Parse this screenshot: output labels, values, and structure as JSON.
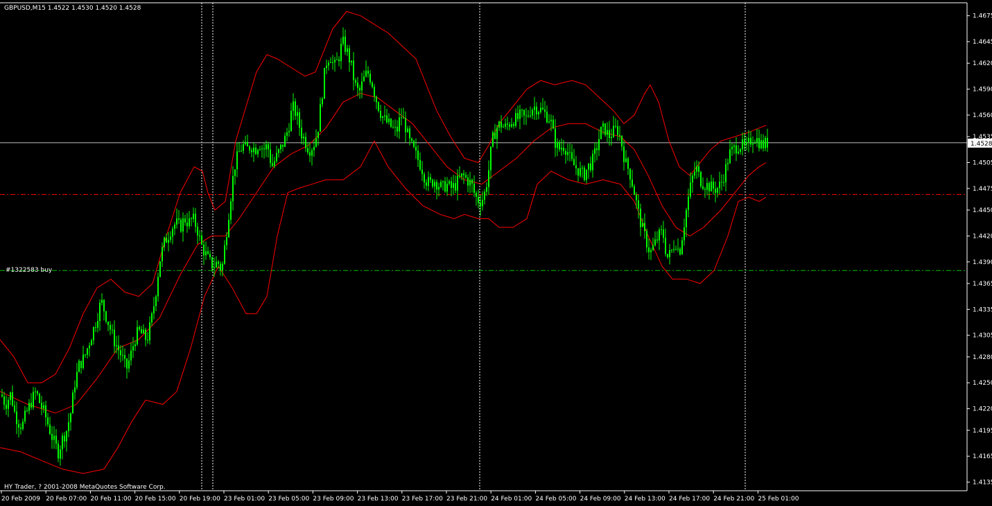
{
  "header": {
    "symbol_info": "GBPUSD,M15  1.4522 1.4530 1.4520 1.4528"
  },
  "footer": {
    "copyright": "HY Trader, ? 2001-2008 MetaQuotes Software Corp."
  },
  "order_label": "#1322583 buy",
  "current_price_label": "1.4528",
  "colors": {
    "background": "#000000",
    "candles": "#00ff00",
    "bands": "#ff0000",
    "bid_line": "#c0c0c0",
    "tp_line": "#ff0000",
    "order_line": "#00c000",
    "separator": "#ffffff",
    "axis": "#ffffff"
  },
  "chart_data": {
    "type": "candlestick",
    "symbol": "GBPUSD",
    "timeframe": "M15",
    "indicator": "Bollinger Bands",
    "ylim": [
      1.4125,
      1.469
    ],
    "y_ticks": [
      "1.4675",
      "1.4645",
      "1.4620",
      "1.4590",
      "1.4560",
      "1.4535",
      "1.4505",
      "1.4475",
      "1.4450",
      "1.4420",
      "1.4390",
      "1.4365",
      "1.4335",
      "1.4305",
      "1.4280",
      "1.4250",
      "1.4220",
      "1.4195",
      "1.4165",
      "1.4135"
    ],
    "x_ticks": [
      "20 Feb 2009",
      "20 Feb 07:00",
      "20 Feb 11:00",
      "20 Feb 15:00",
      "20 Feb 19:00",
      "23 Feb 01:00",
      "23 Feb 05:00",
      "23 Feb 09:00",
      "23 Feb 13:00",
      "23 Feb 17:00",
      "23 Feb 21:00",
      "24 Feb 01:00",
      "24 Feb 05:00",
      "24 Feb 09:00",
      "24 Feb 13:00",
      "24 Feb 17:00",
      "24 Feb 21:00",
      "25 Feb 01:00"
    ],
    "current_price": 1.4528,
    "horizontal_lines": [
      {
        "kind": "take-profit",
        "price": 1.4468
      },
      {
        "kind": "order",
        "price": 1.438
      }
    ],
    "close_path": [
      [
        0,
        1.424
      ],
      [
        8,
        1.4225
      ],
      [
        16,
        1.4238
      ],
      [
        20,
        1.4218
      ],
      [
        26,
        1.4205
      ],
      [
        32,
        1.42
      ],
      [
        38,
        1.4215
      ],
      [
        46,
        1.423
      ],
      [
        52,
        1.424
      ],
      [
        58,
        1.4225
      ],
      [
        64,
        1.4215
      ],
      [
        70,
        1.42
      ],
      [
        76,
        1.4185
      ],
      [
        84,
        1.417
      ],
      [
        90,
        1.4185
      ],
      [
        96,
        1.4195
      ],
      [
        102,
        1.4215
      ],
      [
        108,
        1.425
      ],
      [
        114,
        1.427
      ],
      [
        122,
        1.428
      ],
      [
        130,
        1.43
      ],
      [
        138,
        1.432
      ],
      [
        146,
        1.4345
      ],
      [
        152,
        1.433
      ],
      [
        158,
        1.4315
      ],
      [
        164,
        1.43
      ],
      [
        170,
        1.429
      ],
      [
        176,
        1.428
      ],
      [
        182,
        1.4265
      ],
      [
        188,
        1.428
      ],
      [
        194,
        1.43
      ],
      [
        200,
        1.431
      ],
      [
        206,
        1.4305
      ],
      [
        212,
        1.43
      ],
      [
        218,
        1.432
      ],
      [
        224,
        1.435
      ],
      [
        230,
        1.439
      ],
      [
        236,
        1.441
      ],
      [
        242,
        1.442
      ],
      [
        248,
        1.443
      ],
      [
        254,
        1.4435
      ],
      [
        260,
        1.443
      ],
      [
        266,
        1.444
      ],
      [
        272,
        1.4435
      ],
      [
        278,
        1.444
      ],
      [
        284,
        1.443
      ],
      [
        290,
        1.441
      ],
      [
        296,
        1.44
      ],
      [
        302,
        1.439
      ],
      [
        308,
        1.4385
      ],
      [
        314,
        1.439
      ],
      [
        320,
        1.438
      ],
      [
        326,
        1.442
      ],
      [
        332,
        1.446
      ],
      [
        338,
        1.45
      ],
      [
        344,
        1.4515
      ],
      [
        350,
        1.4525
      ],
      [
        356,
        1.452
      ],
      [
        362,
        1.4525
      ],
      [
        368,
        1.452
      ],
      [
        374,
        1.4528
      ],
      [
        380,
        1.452
      ],
      [
        386,
        1.4525
      ],
      [
        392,
        1.45
      ],
      [
        398,
        1.451
      ],
      [
        404,
        1.452
      ],
      [
        410,
        1.453
      ],
      [
        416,
        1.4545
      ],
      [
        422,
        1.457
      ],
      [
        428,
        1.456
      ],
      [
        434,
        1.454
      ],
      [
        440,
        1.453
      ],
      [
        446,
        1.452
      ],
      [
        452,
        1.4525
      ],
      [
        458,
        1.454
      ],
      [
        464,
        1.458
      ],
      [
        470,
        1.462
      ],
      [
        476,
        1.463
      ],
      [
        482,
        1.4615
      ],
      [
        488,
        1.4625
      ],
      [
        494,
        1.4645
      ],
      [
        500,
        1.4635
      ],
      [
        506,
        1.462
      ],
      [
        512,
        1.4595
      ],
      [
        518,
        1.4585
      ],
      [
        524,
        1.46
      ],
      [
        530,
        1.461
      ],
      [
        536,
        1.46
      ],
      [
        542,
        1.458
      ],
      [
        548,
        1.4565
      ],
      [
        554,
        1.4555
      ],
      [
        560,
        1.455
      ],
      [
        566,
        1.4545
      ],
      [
        572,
        1.454
      ],
      [
        578,
        1.456
      ],
      [
        584,
        1.455
      ],
      [
        590,
        1.453
      ],
      [
        596,
        1.452
      ],
      [
        602,
        1.451
      ],
      [
        608,
        1.45
      ],
      [
        614,
        1.4485
      ],
      [
        620,
        1.448
      ],
      [
        626,
        1.4485
      ],
      [
        632,
        1.448
      ],
      [
        638,
        1.4475
      ],
      [
        644,
        1.448
      ],
      [
        650,
        1.4475
      ],
      [
        656,
        1.4478
      ],
      [
        662,
        1.4485
      ],
      [
        668,
        1.449
      ],
      [
        674,
        1.4485
      ],
      [
        680,
        1.448
      ],
      [
        686,
        1.4465
      ],
      [
        692,
        1.446
      ],
      [
        698,
        1.4465
      ],
      [
        704,
        1.449
      ],
      [
        710,
        1.453
      ],
      [
        716,
        1.4545
      ],
      [
        722,
        1.455
      ],
      [
        728,
        1.4545
      ],
      [
        734,
        1.455
      ],
      [
        740,
        1.4555
      ],
      [
        746,
        1.4555
      ],
      [
        752,
        1.456
      ],
      [
        758,
        1.4555
      ],
      [
        764,
        1.4565
      ],
      [
        770,
        1.457
      ],
      [
        776,
        1.4568
      ],
      [
        782,
        1.4565
      ],
      [
        788,
        1.456
      ],
      [
        794,
        1.4555
      ],
      [
        800,
        1.453
      ],
      [
        806,
        1.452
      ],
      [
        812,
        1.4525
      ],
      [
        818,
        1.452
      ],
      [
        824,
        1.4505
      ],
      [
        830,
        1.45
      ],
      [
        836,
        1.4495
      ],
      [
        842,
        1.449
      ],
      [
        848,
        1.45
      ],
      [
        854,
        1.4505
      ],
      [
        860,
        1.452
      ],
      [
        866,
        1.454
      ],
      [
        872,
        1.4545
      ],
      [
        878,
        1.4535
      ],
      [
        884,
        1.454
      ],
      [
        890,
        1.4545
      ],
      [
        896,
        1.453
      ],
      [
        902,
        1.4505
      ],
      [
        908,
        1.4495
      ],
      [
        914,
        1.4475
      ],
      [
        920,
        1.445
      ],
      [
        926,
        1.443
      ],
      [
        932,
        1.4415
      ],
      [
        938,
        1.44
      ],
      [
        944,
        1.441
      ],
      [
        950,
        1.442
      ],
      [
        956,
        1.4425
      ],
      [
        962,
        1.4395
      ],
      [
        968,
        1.44
      ],
      [
        974,
        1.4415
      ],
      [
        980,
        1.44
      ],
      [
        986,
        1.443
      ],
      [
        992,
        1.446
      ],
      [
        998,
        1.4485
      ],
      [
        1004,
        1.45
      ],
      [
        1010,
        1.4485
      ],
      [
        1016,
        1.448
      ],
      [
        1022,
        1.4478
      ],
      [
        1028,
        1.4475
      ],
      [
        1034,
        1.4475
      ],
      [
        1040,
        1.448
      ],
      [
        1046,
        1.4495
      ],
      [
        1052,
        1.4515
      ],
      [
        1058,
        1.452
      ],
      [
        1064,
        1.4525
      ],
      [
        1070,
        1.4525
      ],
      [
        1076,
        1.452
      ],
      [
        1082,
        1.453
      ],
      [
        1088,
        1.4535
      ],
      [
        1094,
        1.453
      ],
      [
        1100,
        1.4525
      ],
      [
        1106,
        1.4528
      ]
    ],
    "upper_band": [
      [
        0,
        1.43
      ],
      [
        20,
        1.428
      ],
      [
        40,
        1.425
      ],
      [
        60,
        1.425
      ],
      [
        80,
        1.426
      ],
      [
        100,
        1.429
      ],
      [
        120,
        1.433
      ],
      [
        140,
        1.436
      ],
      [
        160,
        1.437
      ],
      [
        180,
        1.4355
      ],
      [
        200,
        1.435
      ],
      [
        220,
        1.4365
      ],
      [
        240,
        1.442
      ],
      [
        260,
        1.447
      ],
      [
        280,
        1.45
      ],
      [
        292,
        1.4495
      ],
      [
        300,
        1.447
      ],
      [
        310,
        1.445
      ],
      [
        325,
        1.446
      ],
      [
        340,
        1.453
      ],
      [
        355,
        1.457
      ],
      [
        370,
        1.461
      ],
      [
        385,
        1.463
      ],
      [
        400,
        1.4625
      ],
      [
        420,
        1.4615
      ],
      [
        440,
        1.4605
      ],
      [
        455,
        1.461
      ],
      [
        465,
        1.463
      ],
      [
        480,
        1.466
      ],
      [
        500,
        1.468
      ],
      [
        520,
        1.4675
      ],
      [
        540,
        1.4665
      ],
      [
        560,
        1.4655
      ],
      [
        580,
        1.464
      ],
      [
        600,
        1.4625
      ],
      [
        615,
        1.4595
      ],
      [
        630,
        1.4565
      ],
      [
        650,
        1.4535
      ],
      [
        670,
        1.451
      ],
      [
        690,
        1.4505
      ],
      [
        705,
        1.4525
      ],
      [
        720,
        1.455
      ],
      [
        740,
        1.457
      ],
      [
        760,
        1.459
      ],
      [
        780,
        1.46
      ],
      [
        800,
        1.4595
      ],
      [
        825,
        1.46
      ],
      [
        845,
        1.4595
      ],
      [
        865,
        1.458
      ],
      [
        885,
        1.4565
      ],
      [
        900,
        1.455
      ],
      [
        915,
        1.456
      ],
      [
        930,
        1.4585
      ],
      [
        938,
        1.4595
      ],
      [
        950,
        1.4575
      ],
      [
        965,
        1.453
      ],
      [
        980,
        1.45
      ],
      [
        995,
        1.449
      ],
      [
        1010,
        1.4505
      ],
      [
        1025,
        1.452
      ],
      [
        1040,
        1.453
      ],
      [
        1060,
        1.4535
      ],
      [
        1080,
        1.454
      ],
      [
        1095,
        1.4545
      ],
      [
        1105,
        1.4548
      ]
    ],
    "middle_band": [
      [
        0,
        1.424
      ],
      [
        40,
        1.4225
      ],
      [
        80,
        1.4215
      ],
      [
        110,
        1.4225
      ],
      [
        140,
        1.4255
      ],
      [
        170,
        1.429
      ],
      [
        200,
        1.43
      ],
      [
        230,
        1.4325
      ],
      [
        260,
        1.4375
      ],
      [
        285,
        1.441
      ],
      [
        305,
        1.442
      ],
      [
        325,
        1.442
      ],
      [
        345,
        1.444
      ],
      [
        370,
        1.447
      ],
      [
        395,
        1.45
      ],
      [
        420,
        1.4515
      ],
      [
        445,
        1.4525
      ],
      [
        470,
        1.4545
      ],
      [
        495,
        1.4575
      ],
      [
        520,
        1.4585
      ],
      [
        545,
        1.458
      ],
      [
        570,
        1.4565
      ],
      [
        595,
        1.455
      ],
      [
        620,
        1.4525
      ],
      [
        645,
        1.45
      ],
      [
        670,
        1.4485
      ],
      [
        695,
        1.448
      ],
      [
        720,
        1.4495
      ],
      [
        745,
        1.451
      ],
      [
        770,
        1.453
      ],
      [
        795,
        1.4545
      ],
      [
        820,
        1.455
      ],
      [
        845,
        1.455
      ],
      [
        870,
        1.454
      ],
      [
        895,
        1.4535
      ],
      [
        915,
        1.452
      ],
      [
        935,
        1.449
      ],
      [
        955,
        1.4455
      ],
      [
        975,
        1.443
      ],
      [
        995,
        1.442
      ],
      [
        1015,
        1.443
      ],
      [
        1040,
        1.445
      ],
      [
        1060,
        1.447
      ],
      [
        1080,
        1.449
      ],
      [
        1095,
        1.45
      ],
      [
        1105,
        1.4505
      ]
    ],
    "lower_band": [
      [
        0,
        1.4175
      ],
      [
        30,
        1.417
      ],
      [
        60,
        1.416
      ],
      [
        90,
        1.415
      ],
      [
        120,
        1.4145
      ],
      [
        150,
        1.415
      ],
      [
        170,
        1.4175
      ],
      [
        190,
        1.4205
      ],
      [
        210,
        1.423
      ],
      [
        235,
        1.4225
      ],
      [
        255,
        1.424
      ],
      [
        275,
        1.429
      ],
      [
        295,
        1.435
      ],
      [
        315,
        1.4385
      ],
      [
        335,
        1.436
      ],
      [
        355,
        1.433
      ],
      [
        370,
        1.433
      ],
      [
        385,
        1.435
      ],
      [
        400,
        1.442
      ],
      [
        415,
        1.447
      ],
      [
        430,
        1.4475
      ],
      [
        450,
        1.448
      ],
      [
        470,
        1.4485
      ],
      [
        495,
        1.4485
      ],
      [
        520,
        1.45
      ],
      [
        540,
        1.453
      ],
      [
        560,
        1.45
      ],
      [
        585,
        1.4475
      ],
      [
        610,
        1.4455
      ],
      [
        635,
        1.4445
      ],
      [
        655,
        1.444
      ],
      [
        670,
        1.4445
      ],
      [
        690,
        1.444
      ],
      [
        705,
        1.444
      ],
      [
        720,
        1.443
      ],
      [
        740,
        1.443
      ],
      [
        760,
        1.444
      ],
      [
        775,
        1.448
      ],
      [
        795,
        1.4495
      ],
      [
        820,
        1.4485
      ],
      [
        845,
        1.448
      ],
      [
        870,
        1.4485
      ],
      [
        895,
        1.448
      ],
      [
        915,
        1.446
      ],
      [
        935,
        1.442
      ],
      [
        955,
        1.4385
      ],
      [
        970,
        1.437
      ],
      [
        990,
        1.437
      ],
      [
        1010,
        1.4365
      ],
      [
        1030,
        1.438
      ],
      [
        1050,
        1.442
      ],
      [
        1065,
        1.446
      ],
      [
        1080,
        1.4465
      ],
      [
        1095,
        1.446
      ],
      [
        1105,
        1.4465
      ]
    ]
  }
}
